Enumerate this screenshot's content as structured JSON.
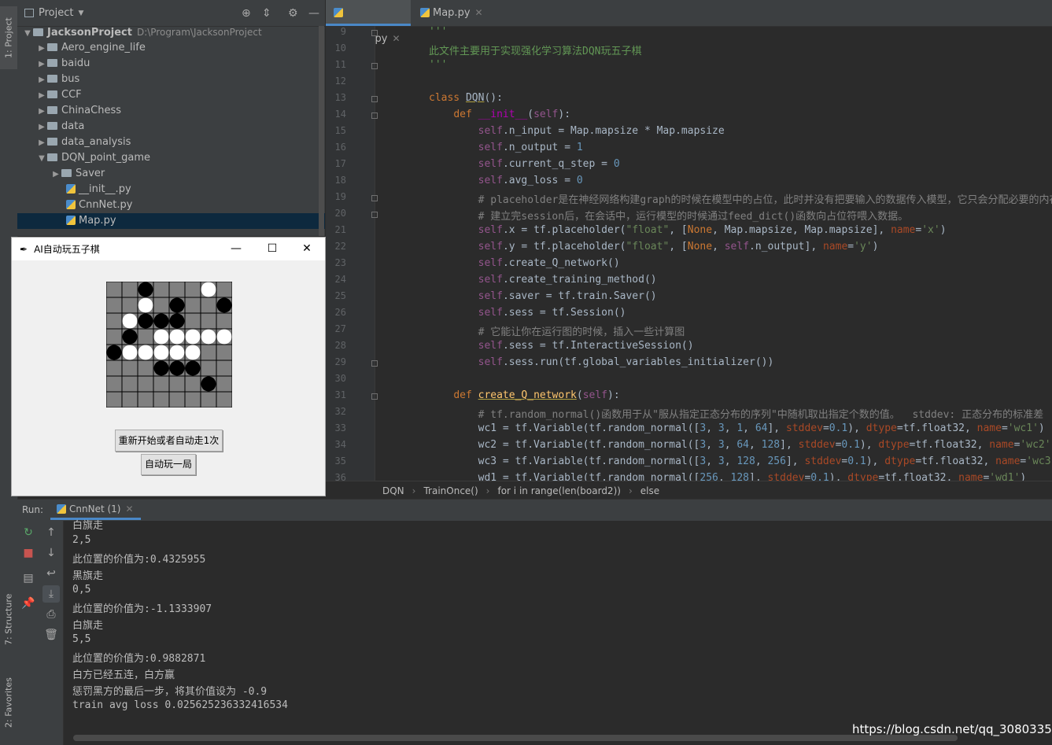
{
  "tool_strip": {
    "project_tab": "1: Project",
    "structure_tab": "7: Structure",
    "favorites_tab": "2: Favorites"
  },
  "project": {
    "header_label": "Project",
    "root_name": "JacksonProject",
    "root_path": "D:\\Program\\JacksonProject",
    "items": [
      {
        "label": "Aero_engine_life"
      },
      {
        "label": "baidu"
      },
      {
        "label": "bus"
      },
      {
        "label": "CCF"
      },
      {
        "label": "ChinaChess"
      },
      {
        "label": "data"
      },
      {
        "label": "data_analysis"
      },
      {
        "label": "DQN_point_game"
      },
      {
        "label": "Saver"
      },
      {
        "label": "__init__.py"
      },
      {
        "label": "CnnNet.py"
      },
      {
        "label": "Map.py"
      }
    ]
  },
  "editor": {
    "tabs": [
      {
        "label": "CnnNet.py"
      },
      {
        "label": "Map.py"
      }
    ],
    "line_numbers": [
      "9",
      "10",
      "11",
      "12",
      "13",
      "14",
      "15",
      "16",
      "17",
      "18",
      "19",
      "20",
      "21",
      "22",
      "23",
      "24",
      "25",
      "26",
      "27",
      "28",
      "29",
      "30",
      "31",
      "32",
      "33",
      "34",
      "35",
      "36"
    ],
    "breadcrumb": [
      "DQN",
      "TrainOnce()",
      "for i in range(len(board2))",
      "else"
    ]
  },
  "run": {
    "label": "Run:",
    "tab": "CnnNet (1)",
    "console_lines": [
      "白旗走",
      "2,5",
      "此位置的价值为:0.4325955",
      "黑旗走",
      "0,5",
      "此位置的价值为:-1.1333907",
      "白旗走",
      "5,5",
      "此位置的价值为:0.9882871",
      "白方已经五连，白方赢",
      "惩罚黑方的最后一步，将其价值设为 -0.9",
      "train avg loss 0.025625236332416534"
    ]
  },
  "tk_window": {
    "title": "AI自动玩五子棋",
    "minimize": "—",
    "maximize": "☐",
    "close": "✕",
    "restart_button": "重新开始或者自动走1次",
    "auto_button": "自动玩一局"
  },
  "board": {
    "size": 8,
    "black_stones": [
      [
        2,
        0
      ],
      [
        2,
        1
      ],
      [
        4,
        1
      ],
      [
        2,
        2
      ],
      [
        3,
        2
      ],
      [
        4,
        2
      ],
      [
        1,
        3
      ],
      [
        4,
        4
      ],
      [
        0,
        4
      ],
      [
        7,
        1
      ],
      [
        4,
        5
      ],
      [
        6,
        3
      ],
      [
        3,
        5
      ],
      [
        5,
        5
      ],
      [
        8,
        4
      ],
      [
        6,
        6
      ]
    ],
    "white_stones": [
      [
        6,
        0
      ],
      [
        2,
        1
      ],
      [
        1,
        2
      ],
      [
        3,
        3
      ],
      [
        4,
        3
      ],
      [
        5,
        3
      ],
      [
        6,
        3
      ],
      [
        7,
        3
      ],
      [
        1,
        4
      ],
      [
        2,
        4
      ],
      [
        3,
        4
      ],
      [
        4,
        4
      ],
      [
        5,
        4
      ]
    ]
  },
  "watermark": "https://blog.csdn.net/qq_30803353"
}
